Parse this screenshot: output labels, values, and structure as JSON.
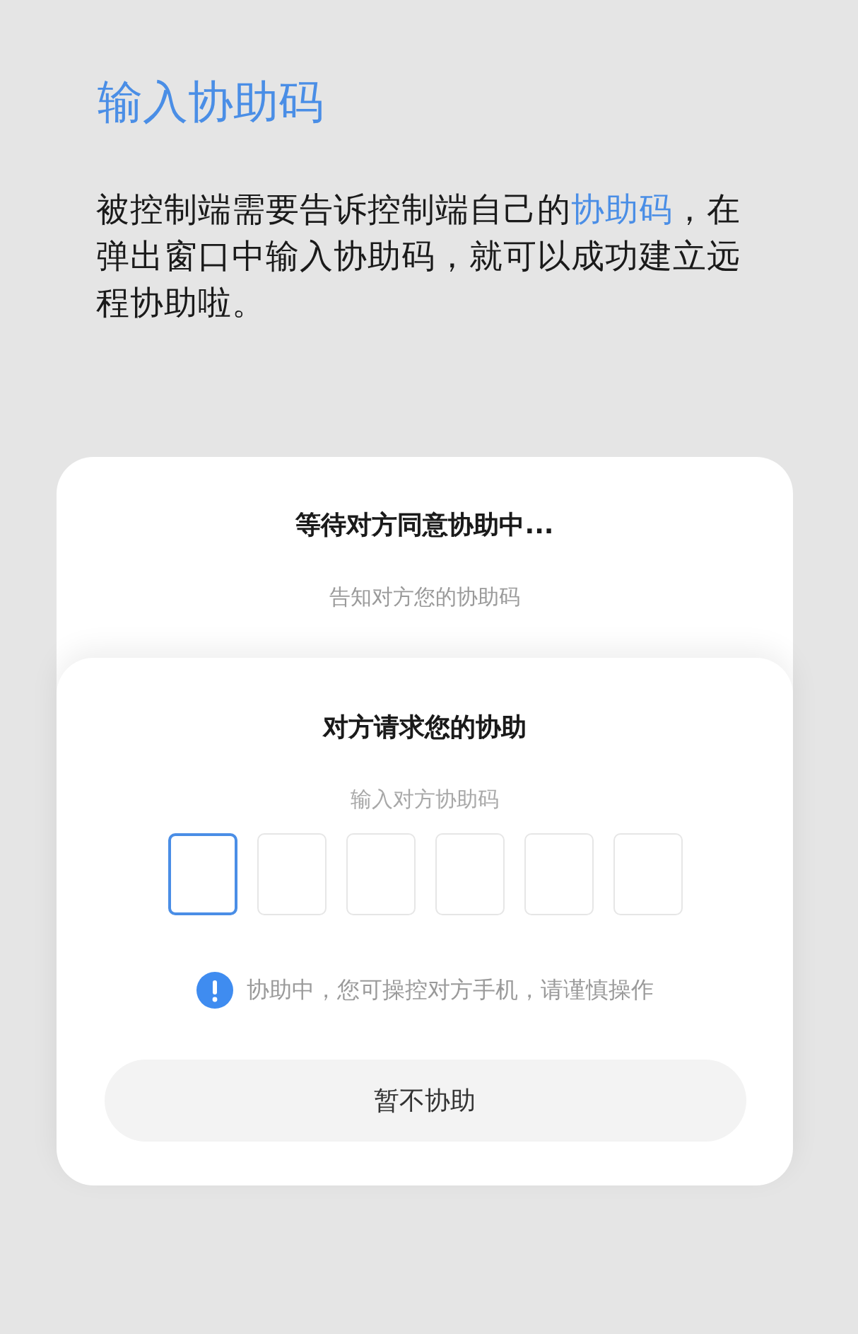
{
  "title": "输入协助码",
  "description": [
    {
      "kind": "plain",
      "text": "被控制端需要告诉控制端自己的"
    },
    {
      "kind": "link",
      "text": "协助码"
    },
    {
      "kind": "plain",
      "text": "，在弹出窗口中输入协助码，就可以成功建立远程协助啦。"
    }
  ],
  "waiting_card": {
    "title": "等待对方同意协助中...",
    "hint": "告知对方您的协助码"
  },
  "request_dialog": {
    "title": "对方请求您的协助",
    "hint": "输入对方协助码",
    "code_boxes": [
      {
        "selected": true
      },
      {
        "selected": false
      },
      {
        "selected": false
      },
      {
        "selected": false
      },
      {
        "selected": false
      },
      {
        "selected": false
      }
    ],
    "notice": "协助中，您可操控对方手机，请谨慎操作",
    "button": "暂不协助"
  }
}
